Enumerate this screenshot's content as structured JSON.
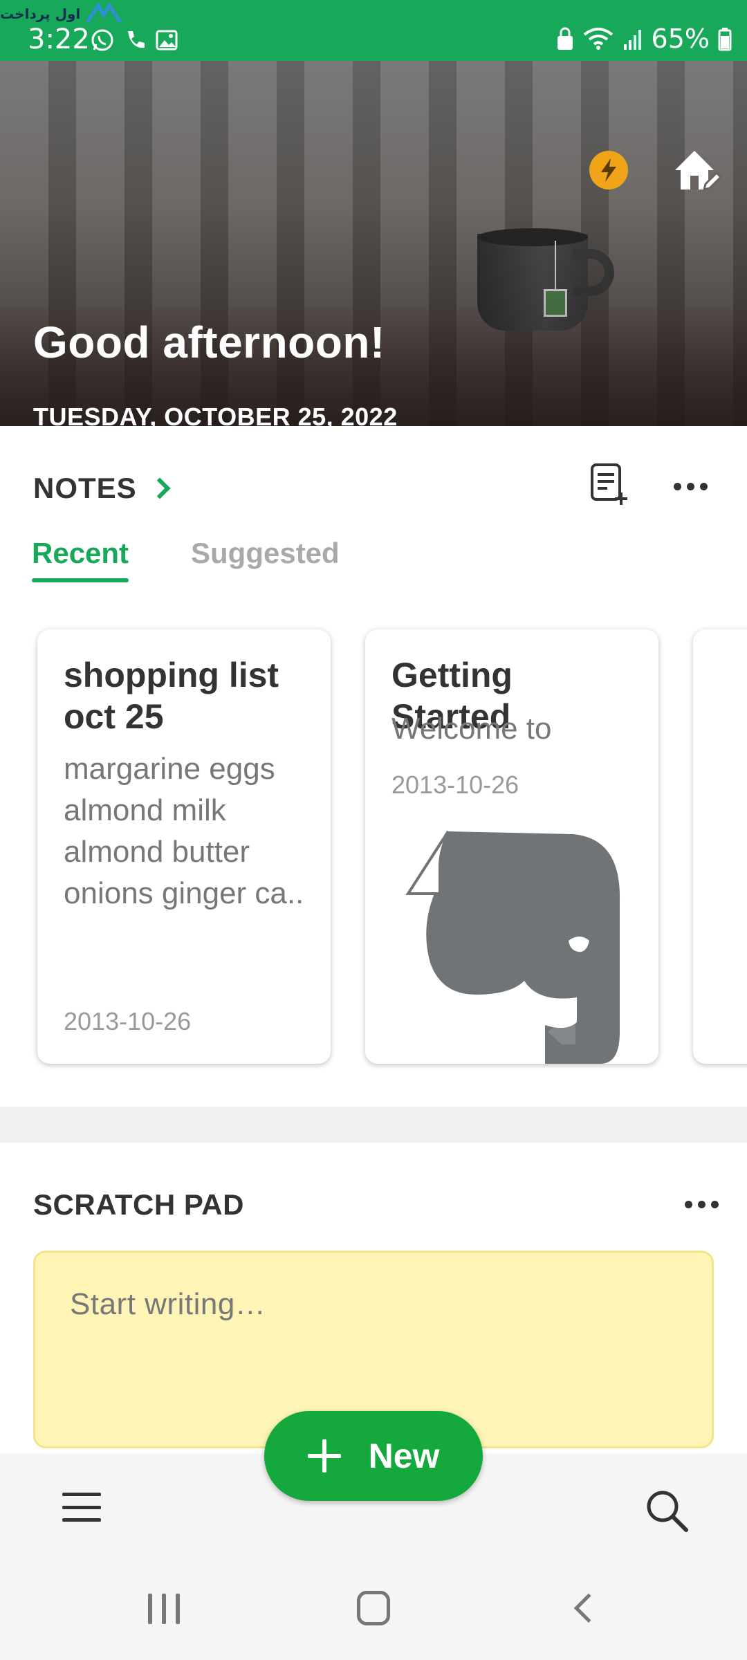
{
  "status_bar": {
    "time": "3:22",
    "battery": "65%",
    "watermark": "اول پرداخت"
  },
  "hero": {
    "greeting": "Good afternoon!",
    "date": "TUESDAY, OCTOBER 25, 2022"
  },
  "notes": {
    "title": "NOTES",
    "tabs": [
      {
        "label": "Recent",
        "active": true
      },
      {
        "label": "Suggested",
        "active": false
      }
    ],
    "cards": [
      {
        "title": "shopping list oct 25",
        "snippet": "margarine eggs almond milk almond butter onions ginger ca..",
        "date": "2013-10-26"
      },
      {
        "title": "Getting Started",
        "snippet": "Welcome to",
        "date": "2013-10-26"
      }
    ]
  },
  "scratch_pad": {
    "title": "SCRATCH PAD",
    "placeholder": "Start writing…"
  },
  "fab": {
    "label": "New"
  },
  "colors": {
    "brand_green": "#18a85a",
    "fab_green": "#15a83c",
    "lightning_orange": "#f0a418",
    "scratch_yellow": "#fdf4b5"
  }
}
